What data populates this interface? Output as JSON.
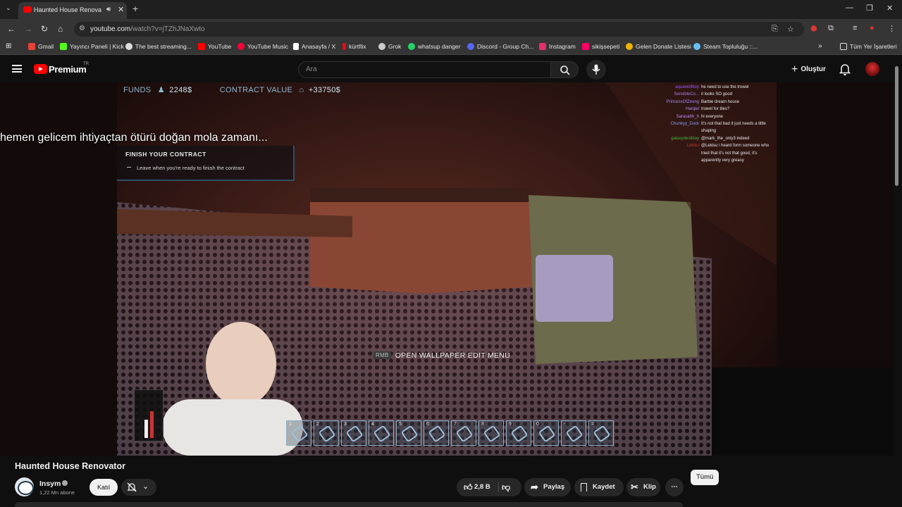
{
  "browser": {
    "tab_title": "Haunted House Renovator",
    "url_host": "youtube.com",
    "url_path": "/watch?v=jTZhJNaXwto",
    "bookmarks": [
      {
        "label": "Gmail",
        "color": "#ea4335"
      },
      {
        "label": "Yayıncı Paneli | Kick",
        "color": "#53fc18"
      },
      {
        "label": "The best streaming...",
        "color": "#dddddd"
      },
      {
        "label": "YouTube",
        "color": "#ff0000"
      },
      {
        "label": "YouTube Music",
        "color": "#ff0033"
      },
      {
        "label": "Anasayfa / X",
        "color": "#ffffff"
      },
      {
        "label": "kürtflix",
        "color": "#e50914"
      },
      {
        "label": "Grok",
        "color": "#cccccc"
      },
      {
        "label": "whatsup danger",
        "color": "#25d366"
      },
      {
        "label": "Discord - Group Ch...",
        "color": "#5865f2"
      },
      {
        "label": "Instagram",
        "color": "#e1306c"
      },
      {
        "label": "sikişsepeti",
        "color": "#ff0066"
      },
      {
        "label": "Gelen Donate Listesi",
        "color": "#f0b400"
      },
      {
        "label": "Steam Topluluğu ::...",
        "color": "#66c0f4"
      }
    ],
    "bookmarks_all": "Tüm Yer İşaretleri"
  },
  "youtube": {
    "logo_text": "Premium",
    "country_code": "TR",
    "search_placeholder": "Ara",
    "create_label": "Oluştur"
  },
  "game": {
    "funds_label": "FUNDS",
    "funds_value": "2248$",
    "contract_label": "CONTRACT VALUE",
    "contract_value": "+33750$",
    "subtitle": "hemen gelicem ihtiyaçtan ötürü doğan mola zamanı...",
    "task_title": "FINISH YOUR CONTRACT",
    "task_desc": "Leave when you're ready to finish the contract",
    "prompt_key": "RMB",
    "prompt_text": "OPEN WALLPAPER EDIT MENU",
    "hotbar": [
      "1",
      "2",
      "3",
      "4",
      "5",
      "6",
      "7",
      "8",
      "9",
      "0",
      "-",
      "="
    ],
    "chat": [
      {
        "user": "aquawolfboy",
        "color": "#9b59ff",
        "msg": "he need to use the trowel"
      },
      {
        "user": "SensibleCo...",
        "color": "#b07cff",
        "msg": "it looks SO good"
      },
      {
        "user": "PrincessOfZeong",
        "color": "#a084ff",
        "msg": "Barbie dream house"
      },
      {
        "user": "Harqiel",
        "color": "#b48cff",
        "msg": "trowel for tiles?"
      },
      {
        "user": "Sarasahh_h",
        "color": "#c58cff",
        "msg": "hi everyone"
      },
      {
        "user": "Chunkyy_Duck",
        "color": "#8f9cff",
        "msg": "It's not that bad it just needs a little shaping"
      },
      {
        "user": "galaxydestiboy",
        "color": "#4bb543",
        "msg": "@mark_the_only3 indeed"
      },
      {
        "user": "Lekisu",
        "color": "#c0392b",
        "msg": "@Lekisu i heard form someone who tried that it's not that good, it's apparently very greasy"
      }
    ]
  },
  "video": {
    "title": "Haunted House Renovator",
    "channel": "Insym",
    "subscribers": "1,22 Mn abone",
    "join_label": "Katıl",
    "likes": "2,8 B",
    "share_label": "Paylaş",
    "save_label": "Kaydet",
    "clip_label": "Klip",
    "more_label": "⋯",
    "all_label": "Tümü"
  }
}
